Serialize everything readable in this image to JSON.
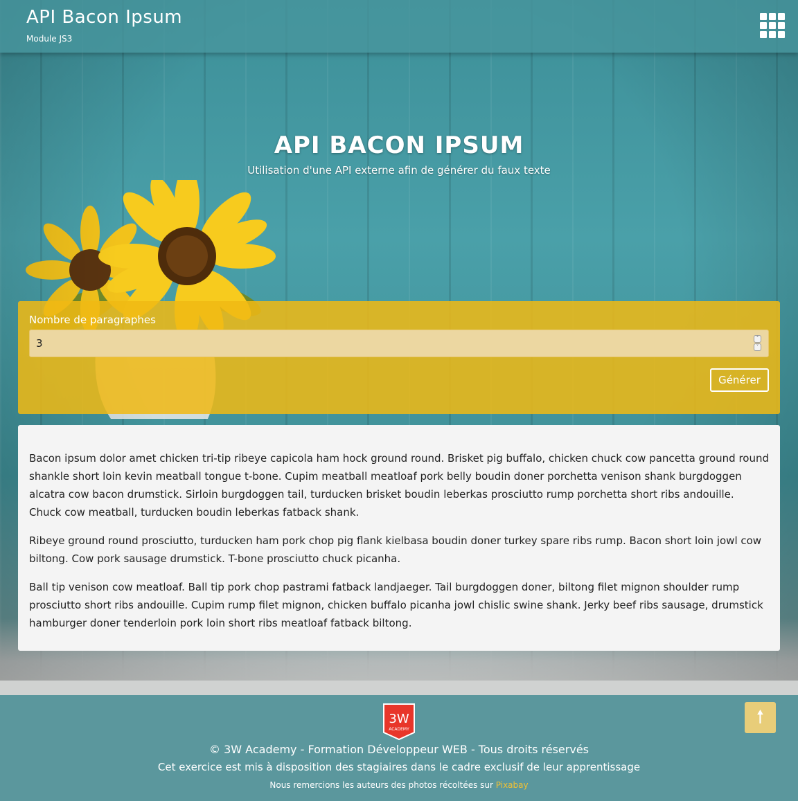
{
  "header": {
    "title": "API Bacon Ipsum",
    "subtitle": "Module JS3",
    "apps_icon": "grid-icon"
  },
  "hero": {
    "title": "API BACON IPSUM",
    "subtitle": "Utilisation d'une API externe afin de générer du faux texte"
  },
  "form": {
    "label": "Nombre de paragraphes",
    "value": "3",
    "submit_label": "Générer",
    "spinner_up": "˄",
    "spinner_down": "˅"
  },
  "output": {
    "paragraphs": [
      "Bacon ipsum dolor amet chicken tri-tip ribeye capicola ham hock ground round. Brisket pig buffalo, chicken chuck cow pancetta ground round shankle short loin kevin meatball tongue t-bone. Cupim meatball meatloaf pork belly boudin doner porchetta venison shank burgdoggen alcatra cow bacon drumstick. Sirloin burgdoggen tail, turducken brisket boudin leberkas prosciutto rump porchetta short ribs andouille. Chuck cow meatball, turducken boudin leberkas fatback shank.",
      "Ribeye ground round prosciutto, turducken ham pork chop pig flank kielbasa boudin doner turkey spare ribs rump. Bacon short loin jowl cow biltong. Cow pork sausage drumstick. T-bone prosciutto chuck picanha.",
      "Ball tip venison cow meatloaf. Ball tip pork chop pastrami fatback landjaeger. Tail burgdoggen doner, biltong filet mignon shoulder rump prosciutto short ribs andouille. Cupim rump filet mignon, chicken buffalo picanha jowl chislic swine shank. Jerky beef ribs sausage, drumstick hamburger doner tenderloin pork loin short ribs meatloaf fatback biltong."
    ]
  },
  "footer": {
    "logo_text_top": "3W",
    "logo_text_bottom": "ACADEMY",
    "copyright": "© 3W Academy - Formation Développeur WEB - Tous droits réservés",
    "notice": "Cet exercice est mis à disposition des stagiaires dans le cadre exclusif de leur apprentissage",
    "credits_prefix": "Nous remercions les auteurs des photos récoltées sur ",
    "credits_link": "Pixabay",
    "to_top_glyph": "🠕"
  },
  "colors": {
    "header_bg": "#4896a0",
    "form_panel": "#f0b914",
    "footer_bg": "#5b979d",
    "link": "#f2c233",
    "to_top_bg": "#e8cd79"
  }
}
